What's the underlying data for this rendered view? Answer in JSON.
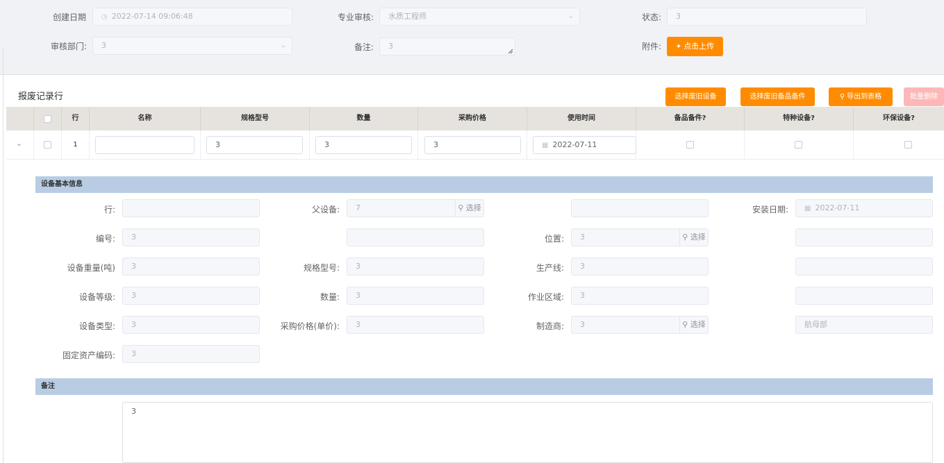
{
  "header": {
    "created_label": "创建日期",
    "created_value": "2022-07-14 09:06:48",
    "reviewer_label": "专业审核:",
    "reviewer_value": "水质工程师",
    "status_label": "状态:",
    "status_value": "3",
    "dept_label": "审核部门:",
    "dept_value": "3",
    "remark_label": "备注:",
    "remark_value": "3",
    "attach_label": "附件:",
    "upload_label": "点击上传"
  },
  "section": {
    "title": "报废记录行",
    "buttons": [
      "选择废旧设备",
      "选择废旧备品备件",
      "导出到表格",
      "批量删除"
    ]
  },
  "table": {
    "headers": [
      "行",
      "名称",
      "规格型号",
      "数量",
      "采购价格",
      "使用时间",
      "备品备件?",
      "特种设备?",
      "环保设备?"
    ],
    "row": {
      "index": "1",
      "name": "",
      "spec": "3",
      "qty": "3",
      "price": "3",
      "date": "2022-07-11"
    }
  },
  "detail": {
    "band_basic": "设备基本信息",
    "band_remark": "备注",
    "select_label": "选择",
    "fields": {
      "row_label": "行:",
      "row_value": "",
      "parent_label": "父设备:",
      "parent_value": "7",
      "c3r1_value": "",
      "install_label": "安装日期:",
      "install_value": "2022-07-11",
      "code_label": "编号:",
      "code_value": "3",
      "c2r2_value": "",
      "location_label": "位置:",
      "location_value": "3",
      "c4r2_value": "",
      "weight_label": "设备重量(吨)",
      "weight_value": "3",
      "spec_label": "规格型号:",
      "spec_value": "3",
      "line_label": "生产线:",
      "line_value": "3",
      "c4r3_value": "",
      "grade_label": "设备等级:",
      "grade_value": "3",
      "qty_label": "数量:",
      "qty_value": "3",
      "area_label": "作业区域:",
      "area_value": "3",
      "c4r4_value": "",
      "type_label": "设备类型:",
      "type_value": "3",
      "price_label": "采购价格(单价):",
      "price_value": "3",
      "maker_label": "制造商:",
      "maker_value": "3",
      "dept_value": "航母部",
      "asset_label": "固定资产编码:",
      "asset_value": "3"
    },
    "remark_text": "3"
  },
  "colors": {
    "accent": "#ff8c00",
    "band": "#b8cde4",
    "header_bg": "#f1f2f5",
    "table_head": "#e6e3df"
  }
}
